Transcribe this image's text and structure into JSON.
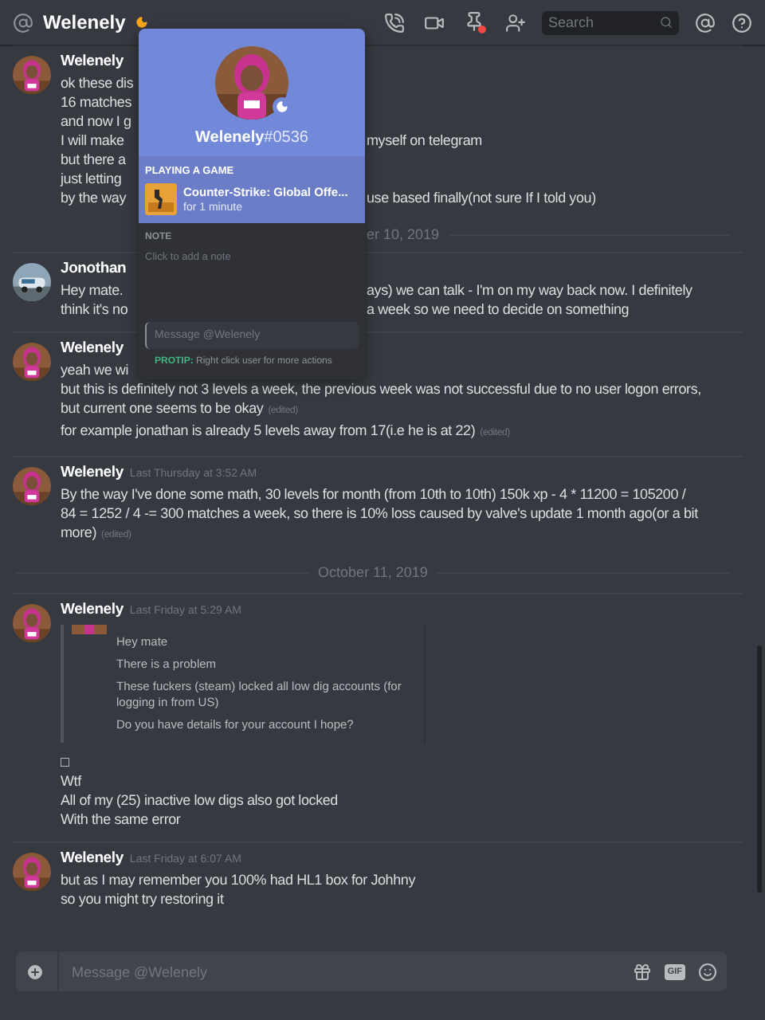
{
  "header": {
    "channel": "Welenely",
    "idle": true,
    "search": {
      "placeholder": "Search"
    }
  },
  "messages": [
    {
      "kind": "message",
      "author": "Welenely",
      "avatar": {
        "kind": "pink"
      },
      "lines": [
        {
          "text": "ok these dis"
        },
        {
          "text": "16 matches"
        },
        {
          "text": "and now I g"
        },
        {
          "text": "I will make",
          "right": "myself on telegram"
        },
        {
          "text": "but there a"
        },
        {
          "text": "just letting"
        },
        {
          "text": "by the way",
          "right": "use based finally(not sure If I told you)"
        }
      ]
    },
    {
      "kind": "divider_cut",
      "label": "er 10, 2019"
    },
    {
      "kind": "message",
      "author": "Jonothan",
      "avatar": {
        "kind": "car"
      },
      "lines": [
        {
          "text": "Hey mate.",
          "right": "ays) we can talk - I'm on my way back now. I definitely"
        },
        {
          "text": "think it's no",
          "right": "a week so we need to decide on something"
        }
      ]
    },
    {
      "kind": "message",
      "author": "Welenely",
      "avatar": {
        "kind": "pink"
      },
      "lines": [
        {
          "text": "yeah we wi"
        },
        {
          "text": "but this is definitely not 3 levels a week, the previous week was not successful due to no user logon errors,"
        },
        {
          "text": "but current one seems to be okay",
          "edited": "(edited)"
        },
        {
          "text": "for example jonathan is already 5 levels away from 17(i.e he is at 22)",
          "edited": "(edited)"
        }
      ]
    },
    {
      "kind": "message",
      "author": "Welenely",
      "timestamp": "Last Thursday at 3:52 AM",
      "avatar": {
        "kind": "pink"
      },
      "lines": [
        {
          "text": "By the way I've done some math, 30 levels for month (from 10th to 10th) 150k xp - 4 * 11200 = 105200 /"
        },
        {
          "text": "84 = 1252 / 4 -= 300 matches a week, so there is 10% loss caused by valve's update 1 month ago(or a bit"
        },
        {
          "text": "more)",
          "edited": "(edited)"
        }
      ]
    },
    {
      "kind": "divider",
      "label": "October 11, 2019"
    },
    {
      "kind": "message",
      "author": "Welenely",
      "timestamp": "Last Friday at 5:29 AM",
      "avatar": {
        "kind": "pink"
      },
      "quote": [
        "Hey mate",
        "There is a problem",
        "These fuckers (steam) locked all low dig accounts (for logging in from US)",
        "Do you have details for your account I hope?"
      ],
      "lines": [
        {
          "text": "□"
        },
        {
          "text": "Wtf"
        },
        {
          "text": "All of my (25) inactive low digs also got locked"
        },
        {
          "text": "With the same error"
        }
      ]
    },
    {
      "kind": "message",
      "author": "Welenely",
      "timestamp": "Last Friday at 6:07 AM",
      "avatar": {
        "kind": "pink"
      },
      "lines": [
        {
          "text": "but as I may remember you 100% had HL1 box for Johhny"
        },
        {
          "text": "so you might try restoring it"
        }
      ]
    }
  ],
  "popup": {
    "username": "Welenely",
    "discriminator": "#0536",
    "idle": true,
    "activity_header": "PLAYING A GAME",
    "game": "Counter-Strike: Global Offe...",
    "duration": "for 1 minute",
    "note_header": "NOTE",
    "note_placeholder": "Click to add a note",
    "message_placeholder": "Message @Welenely",
    "protip_label": "PROTIP:",
    "protip": "Right click user for more actions"
  },
  "composer": {
    "placeholder": "Message @Welenely",
    "gif_label": "GIF"
  }
}
